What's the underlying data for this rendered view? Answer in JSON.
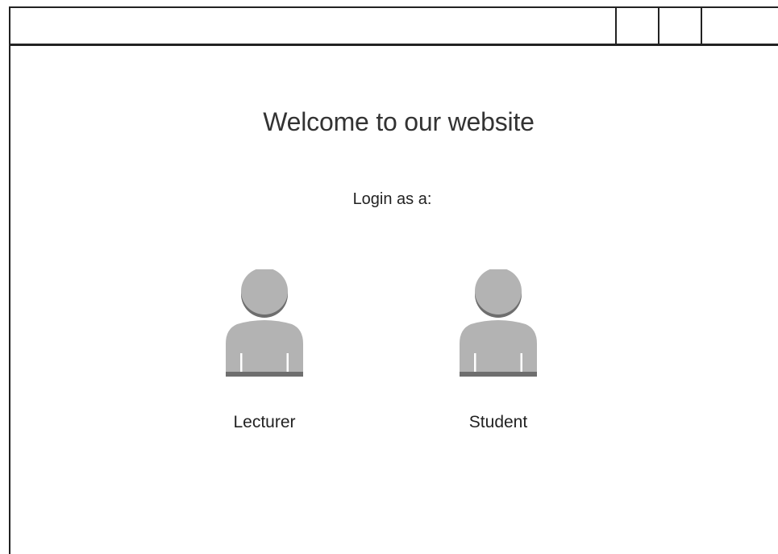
{
  "page": {
    "title": "Welcome to our website",
    "subtitle": "Login as a:"
  },
  "roles": [
    {
      "label": "Lecturer",
      "icon": "user-icon"
    },
    {
      "label": "Student",
      "icon": "user-icon"
    }
  ],
  "colors": {
    "frame": "#222222",
    "icon_fill": "#b3b3b3",
    "icon_shadow": "#6e6e6e"
  }
}
